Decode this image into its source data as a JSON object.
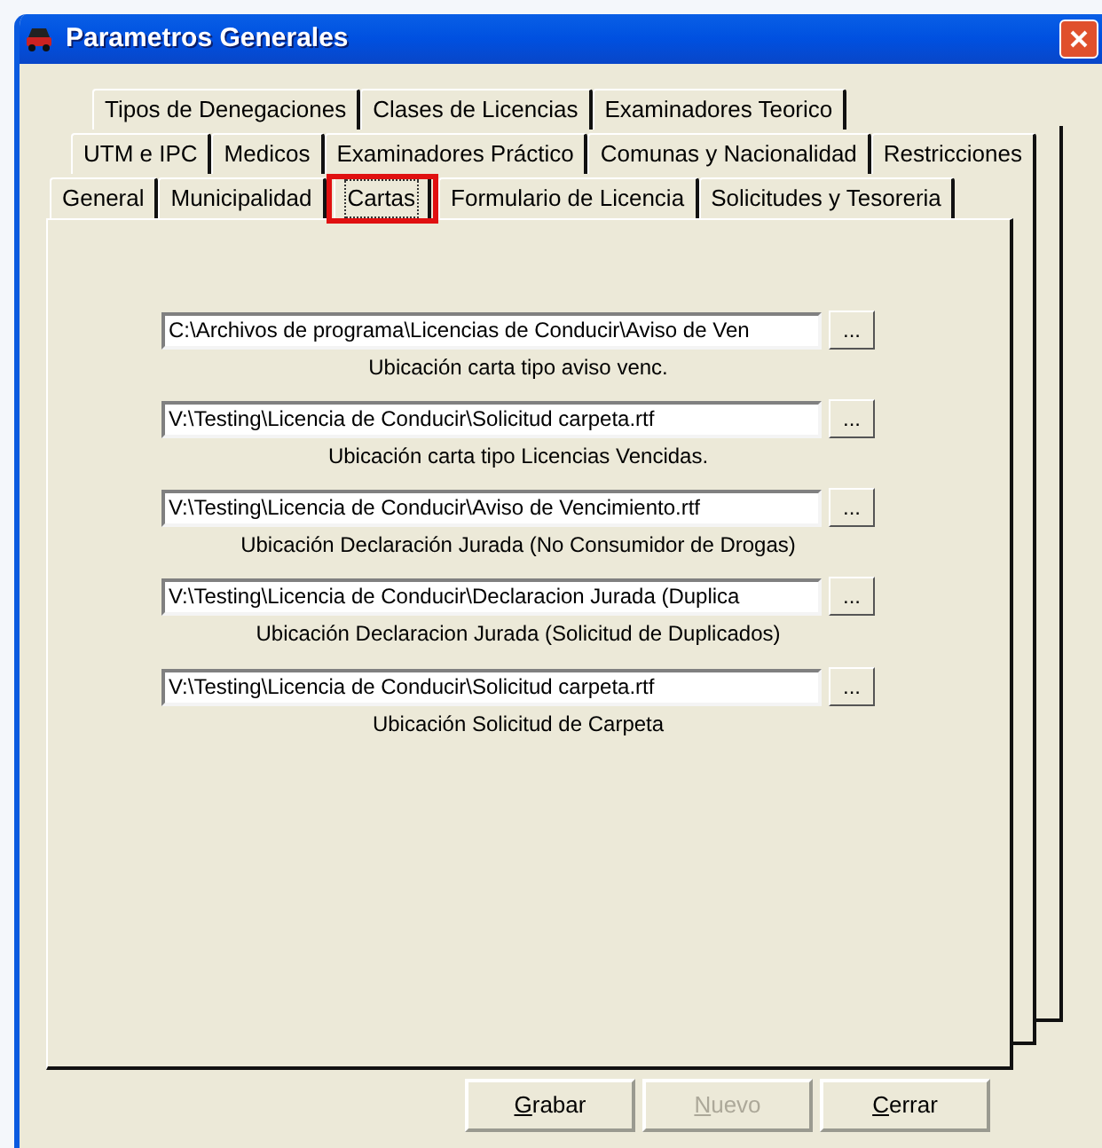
{
  "window": {
    "title": "Parametros Generales"
  },
  "tab_rows": [
    [
      {
        "label": "Tipos de Denegaciones",
        "selected": false
      },
      {
        "label": "Clases de Licencias",
        "selected": false
      },
      {
        "label": "Examinadores Teorico",
        "selected": false
      }
    ],
    [
      {
        "label": "UTM e IPC",
        "selected": false
      },
      {
        "label": "Medicos",
        "selected": false
      },
      {
        "label": "Examinadores Práctico",
        "selected": false
      },
      {
        "label": "Comunas y Nacionalidad",
        "selected": false
      },
      {
        "label": "Restricciones",
        "selected": false
      }
    ],
    [
      {
        "label": "General",
        "selected": false
      },
      {
        "label": "Municipalidad",
        "selected": false
      },
      {
        "label": "Cartas",
        "selected": true,
        "highlighted": true
      },
      {
        "label": "Formulario de Licencia",
        "selected": false
      },
      {
        "label": "Solicitudes y Tesoreria",
        "selected": false
      }
    ]
  ],
  "file_fields": [
    {
      "value": "C:\\Archivos de programa\\Licencias de Conducir\\Aviso de Ven",
      "button": "...",
      "caption": "Ubicación carta tipo aviso venc."
    },
    {
      "value": "V:\\Testing\\Licencia de Conducir\\Solicitud carpeta.rtf",
      "button": "...",
      "caption": "Ubicación carta tipo Licencias Vencidas."
    },
    {
      "value": "V:\\Testing\\Licencia de Conducir\\Aviso de Vencimiento.rtf",
      "button": "...",
      "caption": "Ubicación Declaración Jurada (No Consumidor de Drogas)"
    },
    {
      "value": "V:\\Testing\\Licencia de Conducir\\Declaracion Jurada (Duplica",
      "button": "...",
      "caption": "Ubicación Declaracion Jurada (Solicitud de Duplicados)"
    },
    {
      "value": "V:\\Testing\\Licencia de Conducir\\Solicitud carpeta.rtf",
      "button": "...",
      "caption": "Ubicación Solicitud de Carpeta"
    }
  ],
  "buttons": [
    {
      "label": "Grabar",
      "disabled": false
    },
    {
      "label": "Nuevo",
      "disabled": true
    },
    {
      "label": "Cerrar",
      "disabled": false
    }
  ]
}
